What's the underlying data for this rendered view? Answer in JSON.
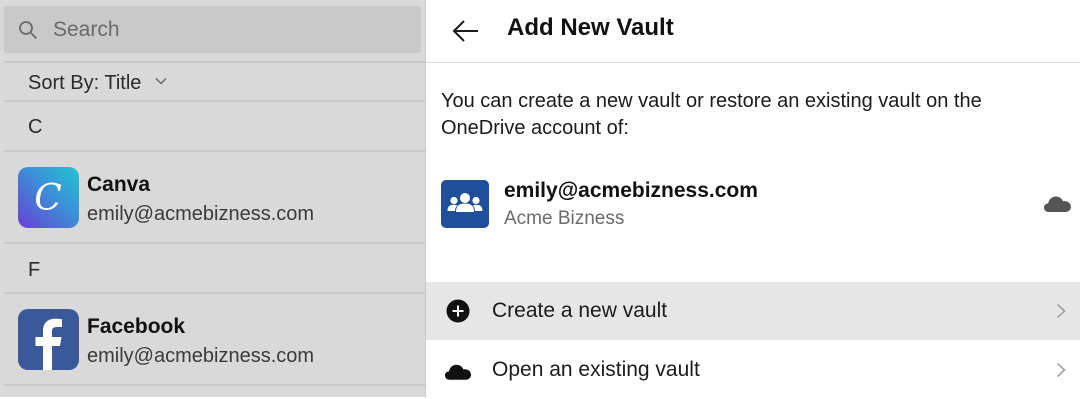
{
  "search": {
    "placeholder": "Search"
  },
  "sort": {
    "label": "Sort By:",
    "value": "Title"
  },
  "groups": [
    {
      "letter": "C",
      "items": [
        {
          "title": "Canva",
          "subtitle": "emily@acmebizness.com",
          "icon": "canva-logo"
        }
      ]
    },
    {
      "letter": "F",
      "items": [
        {
          "title": "Facebook",
          "subtitle": "emily@acmebizness.com",
          "icon": "facebook-logo"
        }
      ]
    }
  ],
  "header": {
    "title": "Add New Vault"
  },
  "description": "You can create a new vault or restore an existing vault on the OneDrive account of:",
  "account": {
    "email": "emily@acmebizness.com",
    "org": "Acme Bizness",
    "icon": "people-icon",
    "status_icon": "cloud-icon"
  },
  "actions": [
    {
      "label": "Create a new vault",
      "icon": "plus-circle-icon"
    },
    {
      "label": "Open an existing vault",
      "icon": "cloud-icon"
    }
  ],
  "colors": {
    "account_icon_bg": "#1f4f9a",
    "facebook": "#3b5998",
    "selected_row": "#e6e6e6",
    "sidebar_bg": "#d9d9d9"
  }
}
